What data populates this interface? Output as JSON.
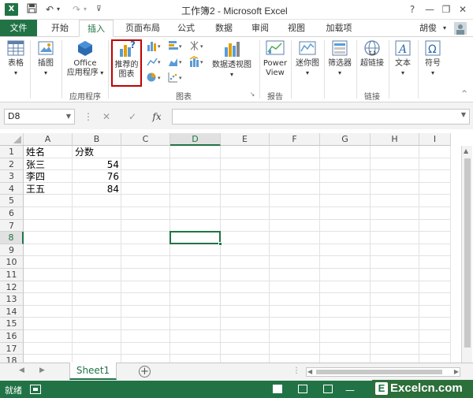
{
  "window": {
    "title": "工作簿2 - Microsoft Excel",
    "user": "胡俊",
    "help": "?",
    "minimize": "—",
    "restore": "❐",
    "close": "✕"
  },
  "qat": {
    "save_icon": "save-icon",
    "undo_icon": "undo-icon",
    "redo_icon": "redo-icon"
  },
  "tabs": [
    {
      "label": "文件"
    },
    {
      "label": "开始"
    },
    {
      "label": "插入"
    },
    {
      "label": "页面布局"
    },
    {
      "label": "公式"
    },
    {
      "label": "数据"
    },
    {
      "label": "审阅"
    },
    {
      "label": "视图"
    },
    {
      "label": "加载项"
    }
  ],
  "ribbon": {
    "table": "表格",
    "illustration": "插图",
    "office_line1": "Office",
    "office_line2": "应用程序",
    "recommended_line1": "推荐的",
    "recommended_line2": "图表",
    "pivot_chart": "数据透视图",
    "power_line1": "Power",
    "power_line2": "View",
    "sparkline": "迷你图",
    "filter": "筛选器",
    "hyperlink": "超链接",
    "text": "文本",
    "symbol": "符号",
    "groups": {
      "apps": "应用程序",
      "charts": "图表",
      "reports": "报告",
      "links": "链接"
    }
  },
  "formula_bar": {
    "name_box": "D8",
    "cancel": "✕",
    "enter": "✓",
    "fx": "fx",
    "value": ""
  },
  "grid": {
    "columns": [
      "A",
      "B",
      "C",
      "D",
      "E",
      "F",
      "G",
      "H",
      "I"
    ],
    "rows": [
      "1",
      "2",
      "3",
      "4",
      "5",
      "6",
      "7",
      "8",
      "9",
      "10",
      "11",
      "12",
      "13",
      "14",
      "15",
      "16",
      "17",
      "18"
    ],
    "active_cell": "D8",
    "cells": {
      "A1": "姓名",
      "B1": "分数",
      "A2": "张三",
      "B2": "54",
      "A3": "李四",
      "B3": "76",
      "A4": "王五",
      "B4": "84"
    }
  },
  "sheets": {
    "active": "Sheet1",
    "add": "+"
  },
  "status": {
    "ready": "就绪"
  },
  "watermark": "Excelcn.com",
  "colors": {
    "accent": "#217346",
    "highlight": "#c00000"
  }
}
